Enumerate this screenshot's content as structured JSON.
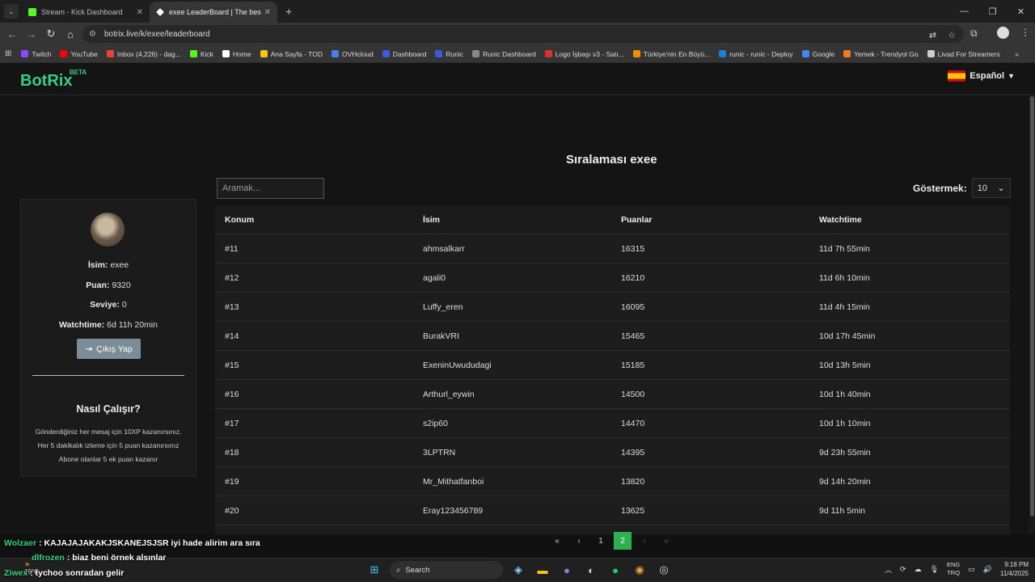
{
  "browser": {
    "tabs": [
      {
        "title": "Stream - Kick Dashboard",
        "favicon_color": "#53fc18",
        "active": false
      },
      {
        "title": "exee LeaderBoard | The best Ch",
        "favicon_color": "#ffffff",
        "active": true
      }
    ],
    "url": "botrix.live/k/exee/leaderboard",
    "bookmarks": [
      {
        "label": "Twitch",
        "color": "#9146ff"
      },
      {
        "label": "YouTube",
        "color": "#ff0000"
      },
      {
        "label": "Inbox (4,226) - dag...",
        "color": "#ea4335"
      },
      {
        "label": "Kick",
        "color": "#53fc18"
      },
      {
        "label": "Home",
        "color": "#ffffff"
      },
      {
        "label": "Ana Sayfa - TOD",
        "color": "#f5c518"
      },
      {
        "label": "OVHcloud",
        "color": "#4b7bec"
      },
      {
        "label": "Dashboard",
        "color": "#3b5bdb"
      },
      {
        "label": "Runic",
        "color": "#3b5bdb"
      },
      {
        "label": "Runic Dashboard",
        "color": "#888888"
      },
      {
        "label": "Logo İşbaşı v3 - Satı...",
        "color": "#e03131"
      },
      {
        "label": "Türkiye'nin En Büyü...",
        "color": "#f08c00"
      },
      {
        "label": "runic - runic - Deploy",
        "color": "#1c7ed6"
      },
      {
        "label": "Google",
        "color": "#4285f4"
      },
      {
        "label": "Yemek - Trendyol Go",
        "color": "#f27a1a"
      },
      {
        "label": "Livad For Streamers",
        "color": "#cccccc"
      }
    ]
  },
  "site": {
    "logo": "BotRix",
    "beta": "BETA",
    "language": "Español"
  },
  "profile": {
    "name_label": "İsim:",
    "name": "exee",
    "points_label": "Puan:",
    "points": "9320",
    "level_label": "Seviye:",
    "level": "0",
    "watchtime_label": "Watchtime:",
    "watchtime": "6d 11h 20min",
    "logout_label": "Çıkış Yap",
    "how_title": "Nasıl Çalışır?",
    "how_lines": [
      "Gönderdiğiniz her mesaj için 10XP kazanırsınız.",
      "Her 5 dakikalık izleme için 5 puan kazanırsınız",
      "Abone olanlar 5 ek puan kazanır"
    ]
  },
  "leaderboard": {
    "title": "Sıralaması exee",
    "search_placeholder": "Aramak...",
    "show_label": "Göstermek:",
    "show_value": "10",
    "columns": [
      "Konum",
      "İsim",
      "Puanlar",
      "Watchtime"
    ],
    "rows": [
      [
        "#11",
        "ahmsalkarr",
        "16315",
        "11d 7h 55min"
      ],
      [
        "#12",
        "agali0",
        "16210",
        "11d 6h 10min"
      ],
      [
        "#13",
        "Luffy_eren",
        "16095",
        "11d 4h 15min"
      ],
      [
        "#14",
        "BurakVRI",
        "15465",
        "10d 17h 45min"
      ],
      [
        "#15",
        "ExeninUwududagi",
        "15185",
        "10d 13h 5min"
      ],
      [
        "#16",
        "Arthurl_eywin",
        "14500",
        "10d 1h 40min"
      ],
      [
        "#17",
        "s2ip60",
        "14470",
        "10d 1h 10min"
      ],
      [
        "#18",
        "3LPTRN",
        "14395",
        "9d 23h 55min"
      ],
      [
        "#19",
        "Mr_Mithatfanboi",
        "13820",
        "9d 14h 20min"
      ],
      [
        "#20",
        "Eray123456789",
        "13625",
        "9d 11h 5min"
      ]
    ],
    "pagination": {
      "pages": [
        "1",
        "2"
      ],
      "current": "2"
    }
  },
  "chat_overlay": [
    {
      "user": "Wolzaer",
      "user_color": "#35d07f",
      "message": ": KAJAJAJAKAKJSKANEJSJSR iyi hade alirim ara sıra"
    },
    {
      "user": "dlfrozen",
      "user_color": "#35d07f",
      "message": ": biaz beni örnek alsınlar"
    },
    {
      "user": "Ziwex",
      "user_color": "#35d07f",
      "message": ": tychoo sonradan gelir"
    }
  ],
  "taskbar": {
    "weather": "15°C",
    "search_label": "Search",
    "input_lang": [
      "ENG",
      "TRQ"
    ],
    "time": "9:18 PM",
    "date": "11/4/2025"
  }
}
